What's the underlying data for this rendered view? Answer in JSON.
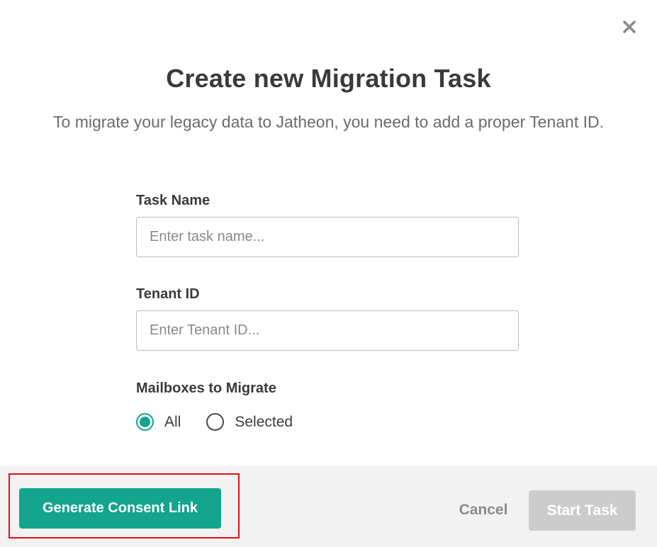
{
  "dialog": {
    "title": "Create new Migration Task",
    "subtitle": "To migrate your legacy data to Jatheon, you need to add a proper Tenant ID.",
    "close_icon": "close-icon"
  },
  "form": {
    "task_name": {
      "label": "Task Name",
      "value": "",
      "placeholder": "Enter task name..."
    },
    "tenant_id": {
      "label": "Tenant ID",
      "value": "",
      "placeholder": "Enter Tenant ID..."
    },
    "mailboxes": {
      "label": "Mailboxes to Migrate",
      "options": [
        {
          "label": "All",
          "checked": true
        },
        {
          "label": "Selected",
          "checked": false
        }
      ]
    }
  },
  "footer": {
    "consent_label": "Generate Consent Link",
    "cancel_label": "Cancel",
    "start_label": "Start Task"
  },
  "colors": {
    "accent": "#13a58d",
    "highlight": "#e0101a",
    "disabled": "#cccccc"
  }
}
